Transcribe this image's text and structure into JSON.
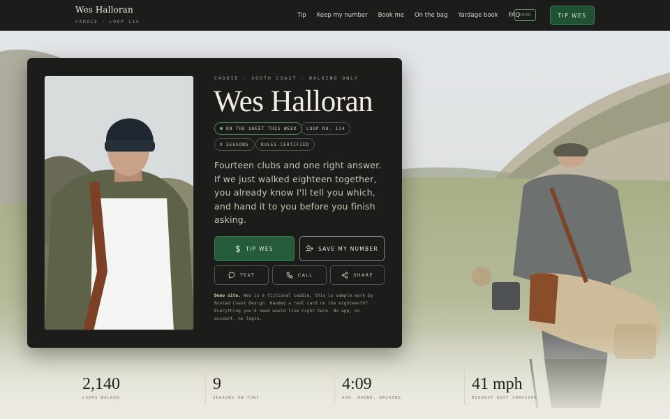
{
  "brand": {
    "name": "Wes Halloran",
    "sub": "CADDIE · LOOP 114"
  },
  "nav": {
    "links": [
      "Tip",
      "Keep my number",
      "Book me",
      "On the bag",
      "Yardage book",
      "FAQ"
    ],
    "demo_badge": "DEMO",
    "tip_button": "TIP WES"
  },
  "card": {
    "eyebrow": "CADDIE · SOUTH COAST · WALKING ONLY",
    "title": "Wes Halloran",
    "chips": [
      "ON THE SHEET THIS WEEK",
      "LOOP NO. 114",
      "9 SEASONS",
      "RULES-CERTIFIED"
    ],
    "lede": "Fourteen clubs and one right answer. If we just walked eighteen together, you already know I'll tell you which, and hand it to you before you finish asking.",
    "buttons": {
      "tip": "TIP WES",
      "save": "SAVE MY NUMBER",
      "text": "TEXT",
      "call": "CALL",
      "share": "SHARE"
    },
    "demo_note": {
      "lead": "Demo site.",
      "body": " Wes is a fictional caddie, this is sample work by Rooted Coast Design. Handed a real card on the eighteenth? Everything you'd need would live right here. No app, no account, no login."
    }
  },
  "stats": [
    {
      "value": "2,140",
      "label": "LOOPS WALKED"
    },
    {
      "value": "9",
      "label": "SEASONS ON TURF"
    },
    {
      "value": "4:09",
      "label": "AVG. ROUND, WALKING"
    },
    {
      "value": "41 mph",
      "label": "BIGGEST GUST SURVIVED"
    }
  ],
  "icons": {
    "tip": "dollar-icon",
    "save": "add-contact-icon",
    "text": "chat-bubble-icon",
    "call": "phone-icon",
    "share": "share-icon",
    "status": "live-dot-icon"
  },
  "colors": {
    "nav_bg": "#1c1c1a",
    "card_bg": "#1c1d1a",
    "accent_green": "#255a3a",
    "live_dot": "#6fb383",
    "note_highlight": "#d8c999"
  }
}
